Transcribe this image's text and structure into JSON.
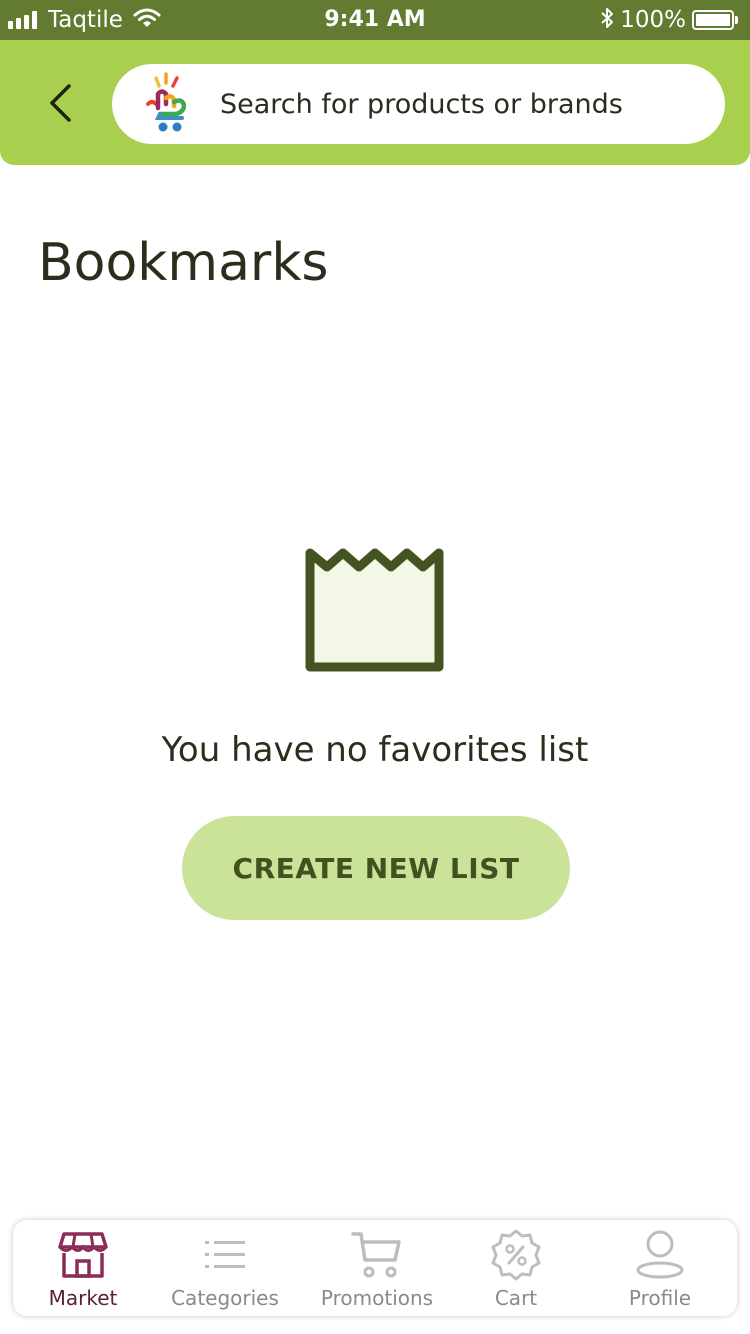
{
  "status_bar": {
    "carrier": "Taqtile",
    "time": "9:41 AM",
    "battery": "100%"
  },
  "header": {
    "search_placeholder": "Search for products or brands"
  },
  "page": {
    "title": "Bookmarks"
  },
  "empty_state": {
    "message": "You have no favorites list",
    "button_label": "CREATE NEW LIST"
  },
  "nav": {
    "items": [
      {
        "label": "Market",
        "icon": "store-icon",
        "active": true
      },
      {
        "label": "Categories",
        "icon": "list-icon",
        "active": false
      },
      {
        "label": "Promotions",
        "icon": "cart-icon",
        "active": false
      },
      {
        "label": "Cart",
        "icon": "discount-badge-icon",
        "active": false
      },
      {
        "label": "Profile",
        "icon": "person-icon",
        "active": false
      }
    ]
  },
  "colors": {
    "status_bar": "#637a31",
    "header": "#a8d04e",
    "button": "#cbe399",
    "active_nav": "#8c2c58",
    "inactive_nav": "#bdbdbd"
  }
}
